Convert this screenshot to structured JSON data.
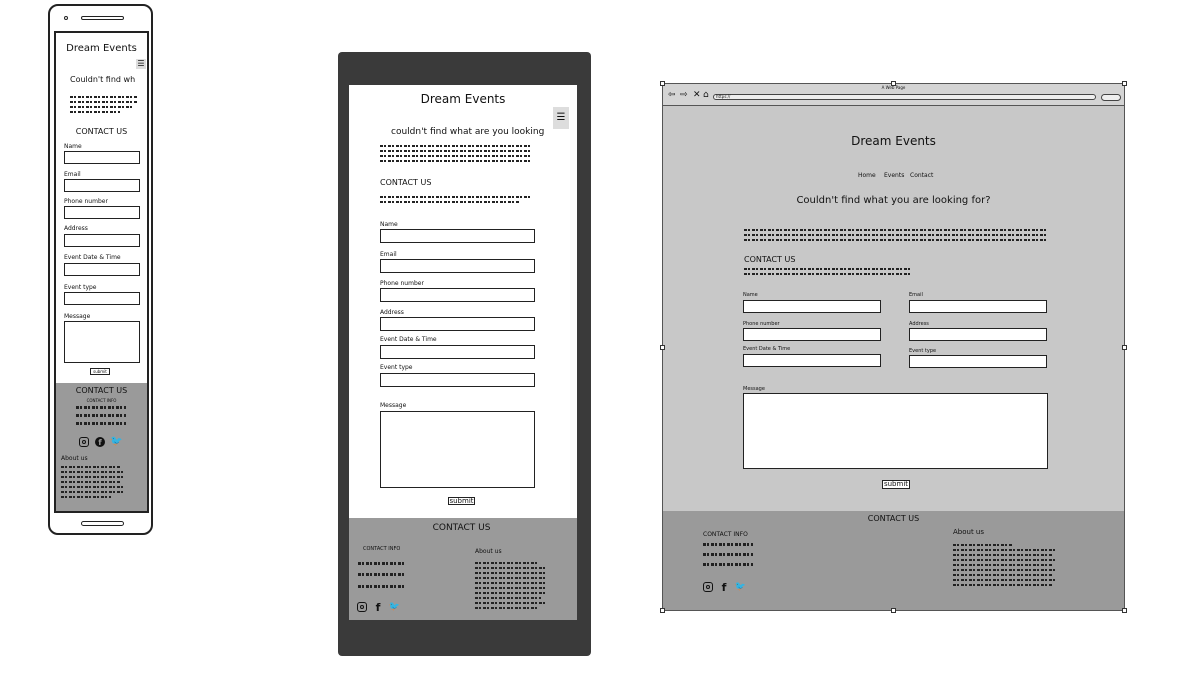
{
  "brand": "Dream Events",
  "phone": {
    "heading": "Couldn't find wh",
    "contact_heading": "CONTACT US",
    "fields": [
      "Name",
      "Email",
      "Phone number",
      "Address",
      "Event Date & Time",
      "Event type",
      "Message"
    ],
    "submit": "submit",
    "footer_title": "CONTACT US",
    "footer_info": "CONTACT INFO",
    "about": "About us"
  },
  "tablet": {
    "heading": "couldn't find what are you looking",
    "contact_heading": "CONTACT US",
    "fields": [
      "Name",
      "Email",
      "Phone number",
      "Address",
      "Event Date & Time",
      "Event type",
      "Message"
    ],
    "submit": "submit",
    "footer_title": "CONTACT US",
    "footer_info": "CONTACT INFO",
    "about": "About us"
  },
  "desktop": {
    "window_title": "A Web Page",
    "url": "https://",
    "nav": [
      "Home",
      "Events",
      "Contact"
    ],
    "heading": "Couldn't find what you are looking for?",
    "contact_heading": "CONTACT US",
    "fields": [
      "Name",
      "Email",
      "Phone number",
      "Address",
      "Event Date & Time",
      "Event type",
      "Message"
    ],
    "submit": "submit",
    "footer_title": "CONTACT US",
    "footer_info": "CONTACT INFO",
    "about": "About us"
  },
  "icons": [
    "instagram-icon",
    "facebook-icon",
    "twitter-icon",
    "hamburger-menu-icon"
  ],
  "colors": {
    "footer_gray": "#9a9a9a",
    "desktop_bg": "#c8c8c8",
    "device_frame": "#3a3a3a"
  }
}
